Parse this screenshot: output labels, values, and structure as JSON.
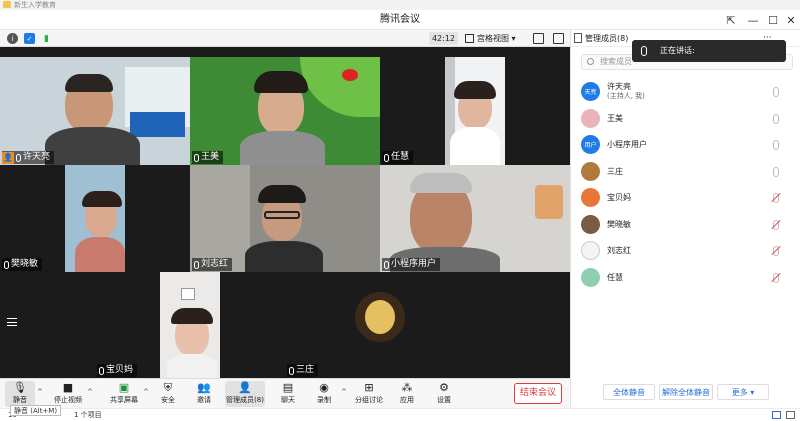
{
  "background": {
    "folder_label": "新生入学教育",
    "status_count": "10",
    "status_items": "1 个项目"
  },
  "window": {
    "title": "腾讯会议"
  },
  "toolbar": {
    "timer": "42:12",
    "view_label": "宫格视图"
  },
  "tiles": [
    {
      "name": "许天亮",
      "is_host": true,
      "host_glyph": "👤"
    },
    {
      "name": "王美"
    },
    {
      "name": "任慧"
    },
    {
      "name": "樊晓敏"
    },
    {
      "name": "刘志红"
    },
    {
      "name": "小程序用户"
    },
    {
      "name": "宝贝妈"
    },
    {
      "name": "三庄"
    }
  ],
  "bottombar": {
    "buttons": [
      {
        "label": "静音",
        "icon": "mic-icon"
      },
      {
        "label": "停止视频",
        "icon": "video-icon"
      },
      {
        "label": "共享屏幕",
        "icon": "share-screen-icon"
      },
      {
        "label": "安全",
        "icon": "shield-icon"
      },
      {
        "label": "邀请",
        "icon": "invite-icon"
      },
      {
        "label": "管理成员(8)",
        "icon": "members-icon"
      },
      {
        "label": "聊天",
        "icon": "chat-icon"
      },
      {
        "label": "录制",
        "icon": "record-icon"
      },
      {
        "label": "分组讨论",
        "icon": "breakout-icon"
      },
      {
        "label": "应用",
        "icon": "apps-icon"
      },
      {
        "label": "设置",
        "icon": "settings-icon"
      }
    ],
    "end_label": "结束会议",
    "tooltip": "静音 (Alt+M)"
  },
  "panel": {
    "title": "管理成员(8)",
    "more_dots": "···",
    "speaking_label": "正在讲话:",
    "search_placeholder": "搜索成员",
    "members": [
      {
        "name": "许天亮",
        "sub": "(主持人, 我)",
        "avatar_text": "天亮",
        "avatar_color": "#1f7be6",
        "muted": false
      },
      {
        "name": "王美",
        "sub": "",
        "avatar_text": "",
        "avatar_color": "#e8b4b8",
        "muted": false
      },
      {
        "name": "小程序用户",
        "sub": "",
        "avatar_text": "用户",
        "avatar_color": "#1f7be6",
        "muted": false
      },
      {
        "name": "三庄",
        "sub": "",
        "avatar_text": "",
        "avatar_color": "#b07a3c",
        "muted": false
      },
      {
        "name": "宝贝妈",
        "sub": "",
        "avatar_text": "",
        "avatar_color": "#e8753a",
        "muted": true
      },
      {
        "name": "樊晓敏",
        "sub": "",
        "avatar_text": "",
        "avatar_color": "#7a5a43",
        "muted": true
      },
      {
        "name": "刘志红",
        "sub": "",
        "avatar_text": "",
        "avatar_color": "#f4f4f4",
        "muted": true
      },
      {
        "name": "任慧",
        "sub": "",
        "avatar_text": "",
        "avatar_color": "#8fcfb1",
        "muted": true
      }
    ],
    "mute_all": "全体静音",
    "unmute_all": "解除全体静音",
    "more": "更多 ▾"
  }
}
